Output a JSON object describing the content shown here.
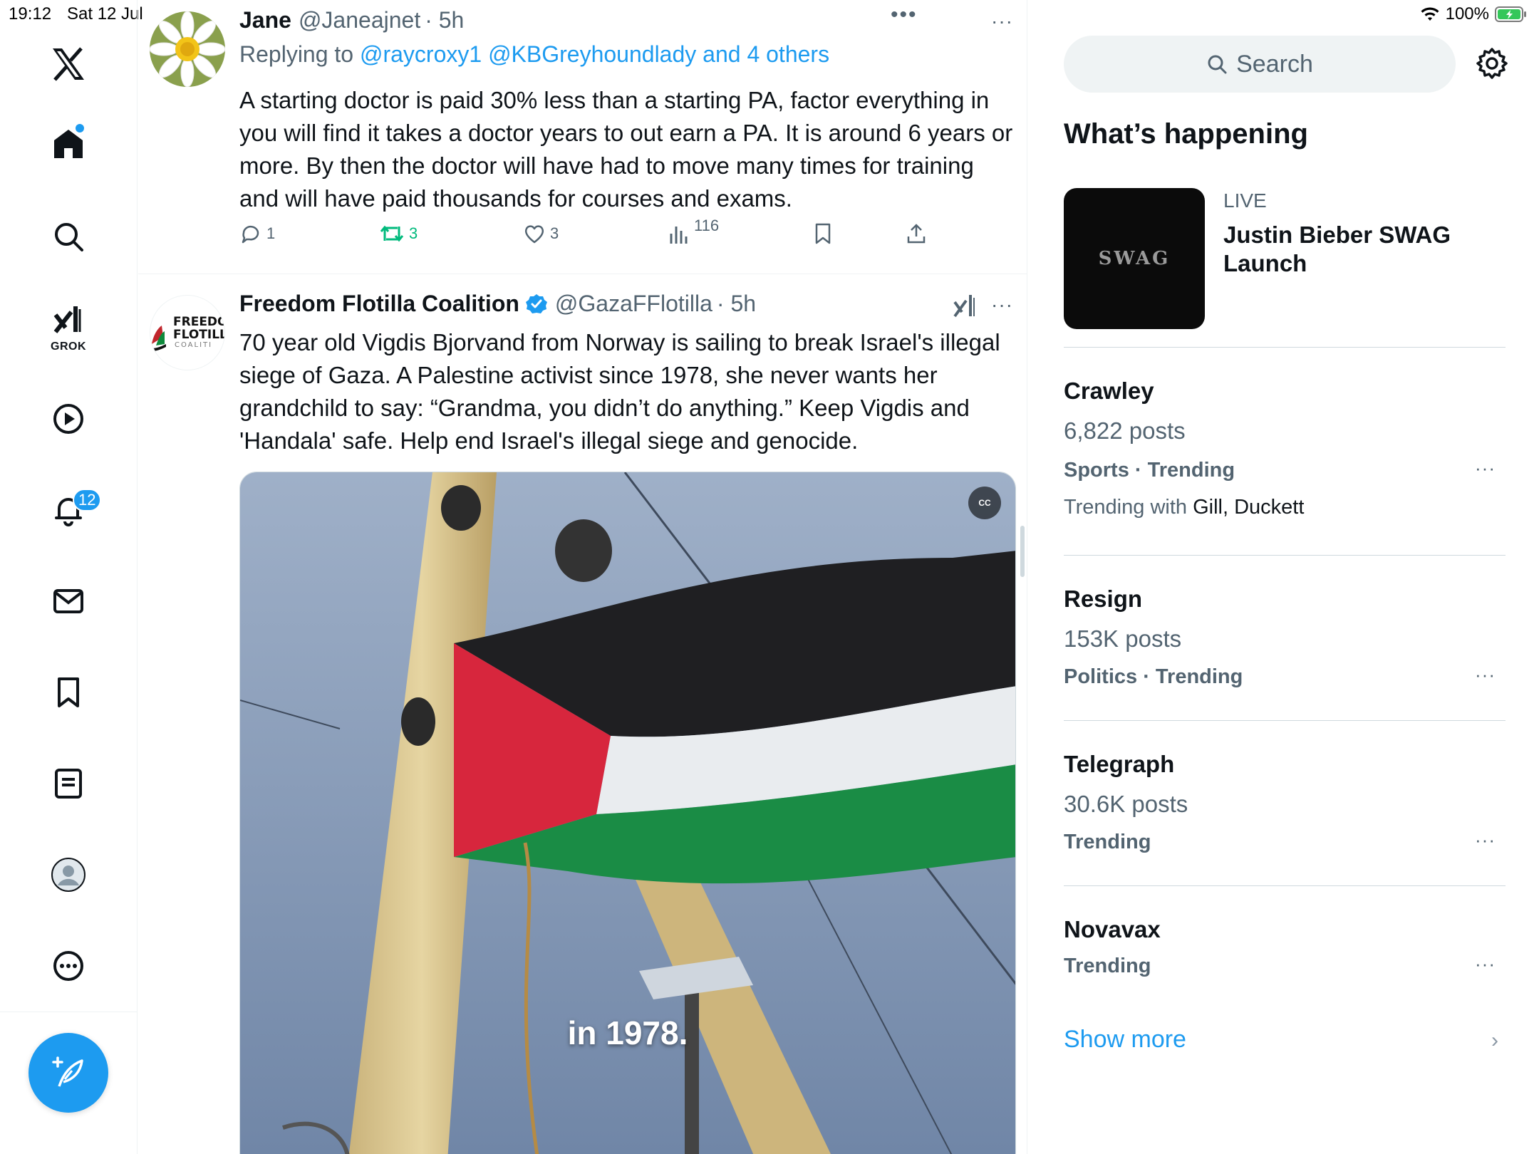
{
  "status_bar": {
    "time": "19:12",
    "date": "Sat 12 Jul",
    "battery": "100%"
  },
  "nav": {
    "grok_label": "GROK",
    "notifications_badge": "12",
    "items": [
      "home-icon",
      "search-icon",
      "grok-icon",
      "video-icon",
      "notifications-icon",
      "messages-icon",
      "bookmarks-icon",
      "lists-icon",
      "profile-icon",
      "more-icon"
    ]
  },
  "timeline": {
    "top_dots": "•••",
    "tweets": [
      {
        "name": "Jane",
        "handle": "@Janeajnet",
        "time": "· 5h",
        "more": "···",
        "replying_prefix": "Replying to ",
        "replying_links": "@raycroxy1 @KBGreyhoundlady and 4 others",
        "body": "A starting doctor is paid 30% less than a starting PA, factor everything in you will find it takes a doctor years to out earn a PA. It is around 6 years or more. By then the doctor will have had to move many times for training and will have paid thousands for courses and exams.",
        "replies": "1",
        "reposts": "3",
        "likes": "3",
        "views": "116"
      },
      {
        "name": "Freedom Flotilla Coalition",
        "handle": "@GazaFFlotilla",
        "time": "· 5h",
        "more": "···",
        "avatar_text": "FREEDO FLOTILL COALITI",
        "body": "70 year old Vigdis Bjorvand from Norway is sailing to break Israel's illegal siege of Gaza. A Palestine activist since 1978, she never wants her grandchild to say: “Grandma, you didn’t do anything.” Keep Vigdis and 'Handala' safe. Help end Israel's illegal siege and  genocide.",
        "media_caption": "in 1978.",
        "cc": "CC"
      }
    ]
  },
  "sidebar": {
    "search_placeholder": "Search",
    "section_title": "What’s happening",
    "live": {
      "label": "LIVE",
      "title": "Justin Bieber SWAG Launch",
      "thumb_text": "SWAG"
    },
    "trends": [
      {
        "name": "Crawley",
        "posts": "6,822 posts",
        "category": "Sports · Trending",
        "with_prefix": "Trending with ",
        "with_names": "Gill, Duckett"
      },
      {
        "name": "Resign",
        "posts": "153K posts",
        "category": "Politics · Trending"
      },
      {
        "name": "Telegraph",
        "posts": "30.6K posts",
        "category": "Trending"
      },
      {
        "name": "Novavax",
        "category": "Trending"
      }
    ],
    "trend_more": "···",
    "show_more": "Show more",
    "show_more_chevron": "›"
  },
  "colors": {
    "accent": "#1d9bf0",
    "repost": "#00ba7c",
    "muted": "#536471"
  }
}
